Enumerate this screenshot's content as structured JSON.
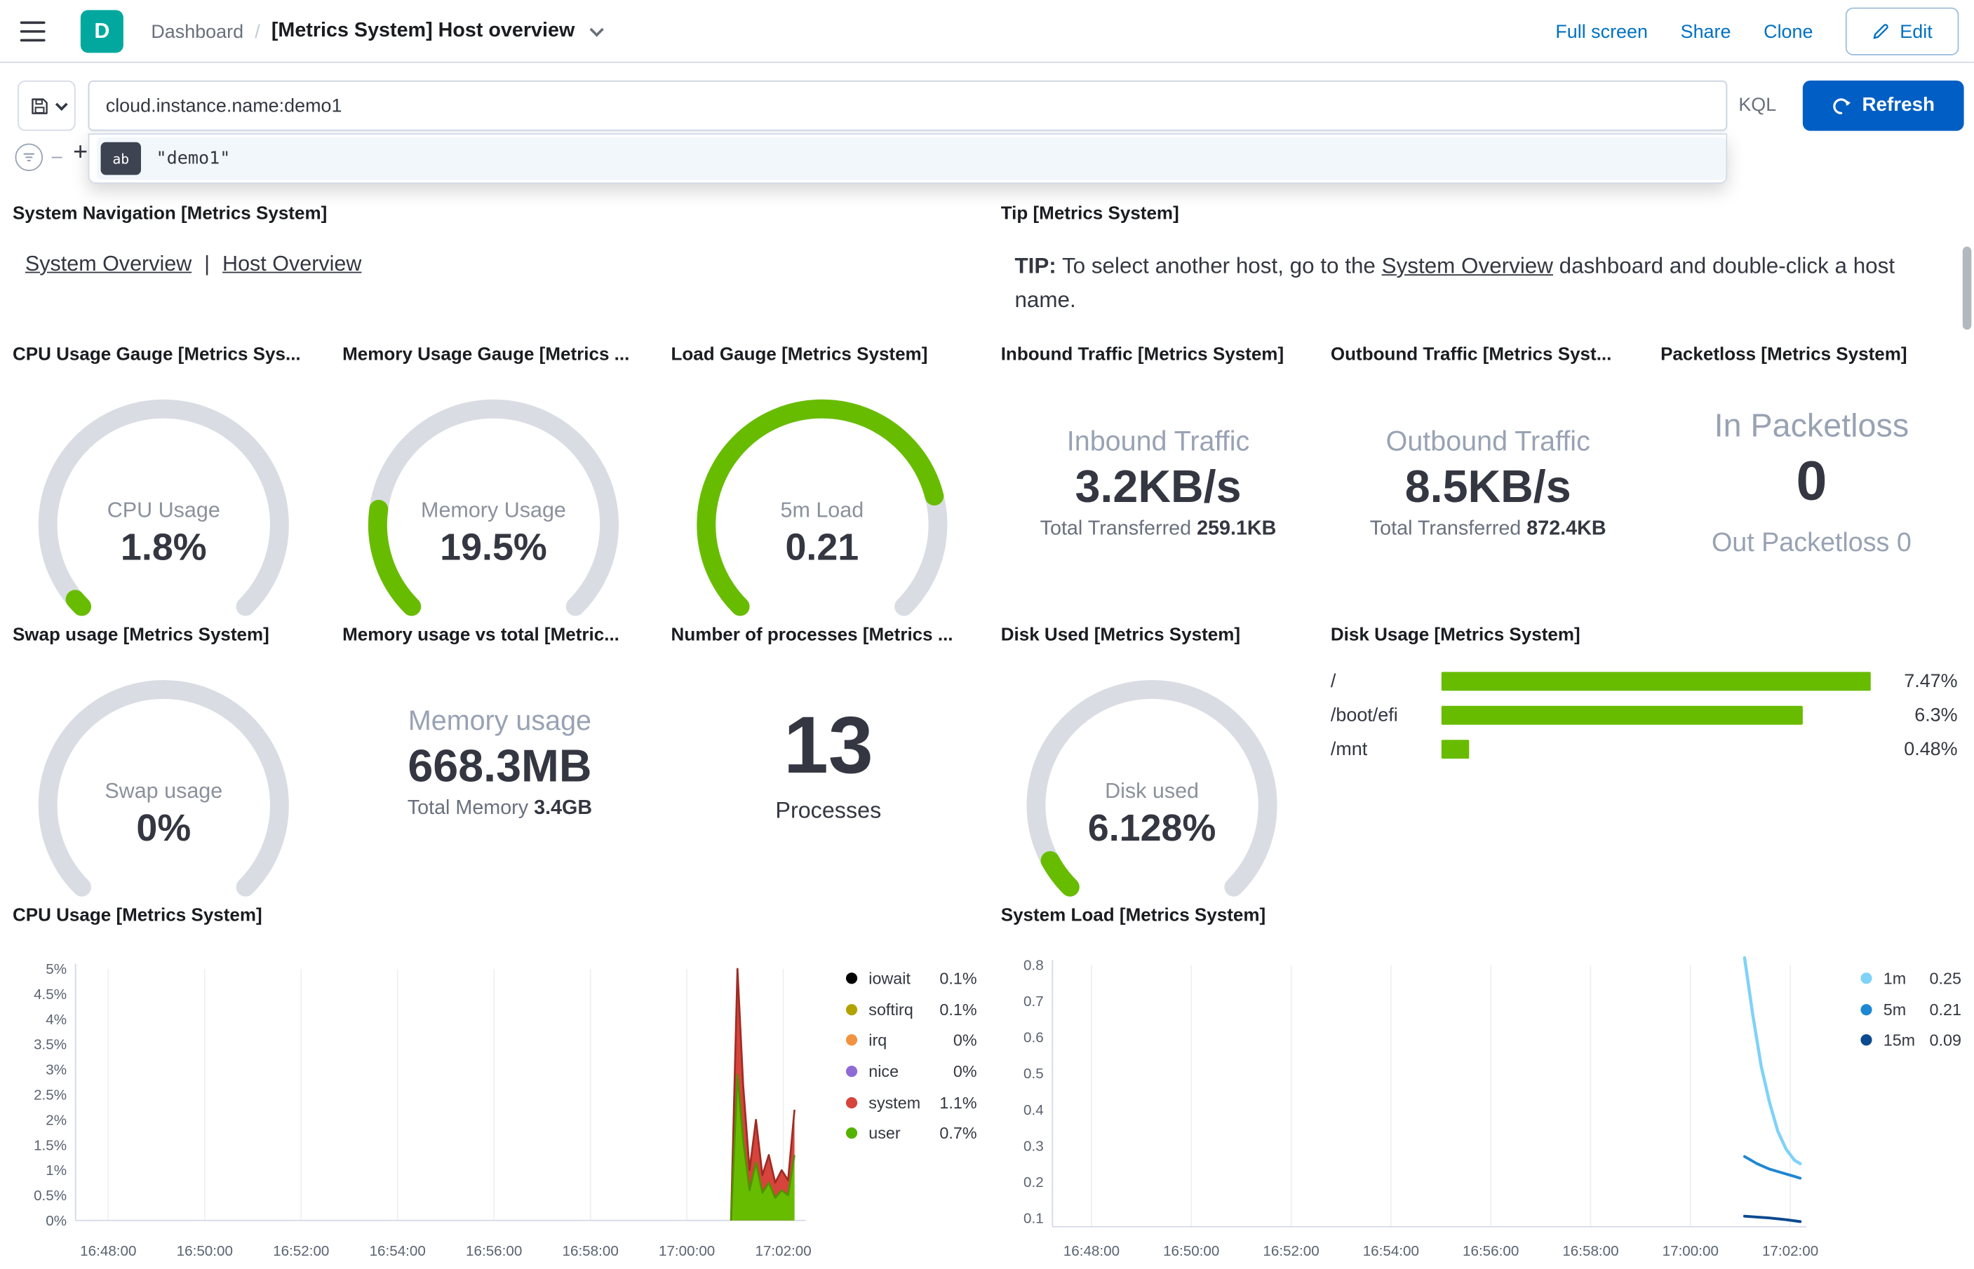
{
  "header": {
    "logo_letter": "D",
    "breadcrumb_root": "Dashboard",
    "breadcrumb_sep": "/",
    "title": "[Metrics System] Host overview",
    "full_screen": "Full screen",
    "share": "Share",
    "clone": "Clone",
    "edit": "Edit"
  },
  "query_bar": {
    "query": "cloud.instance.name:demo1",
    "language": "KQL",
    "refresh": "Refresh",
    "suggestion_value": "\"demo1\"",
    "suggestion_icon_glyph": "ab",
    "add_filter_plus": "+",
    "filter_dash": "–"
  },
  "panels": {
    "system_navigation": {
      "title": "System Navigation [Metrics System]",
      "link1": "System Overview",
      "separator": "|",
      "link2": "Host Overview"
    },
    "tip": {
      "title": "Tip [Metrics System]",
      "bold": "TIP:",
      "pre": " To select another host, go to the ",
      "link": "System Overview",
      "post": " dashboard and double-click a host name."
    },
    "cpu_gauge": {
      "title": "CPU Usage Gauge [Metrics Sys...",
      "label": "CPU Usage",
      "value": "1.8%",
      "fraction": 0.018
    },
    "memory_gauge": {
      "title": "Memory Usage Gauge [Metrics ...",
      "label": "Memory Usage",
      "value": "19.5%",
      "fraction": 0.195
    },
    "load_gauge": {
      "title": "Load Gauge [Metrics System]",
      "label": "5m Load",
      "value": "0.21",
      "fraction": 0.78
    },
    "inbound": {
      "title": "Inbound Traffic [Metrics System]",
      "label": "Inbound Traffic",
      "value": "3.2KB/s",
      "sub_label": "Total Transferred",
      "sub_value": "259.1KB"
    },
    "outbound": {
      "title": "Outbound Traffic [Metrics Syst...",
      "label": "Outbound Traffic",
      "value": "8.5KB/s",
      "sub_label": "Total Transferred",
      "sub_value": "872.4KB"
    },
    "packetloss": {
      "title": "Packetloss [Metrics System]",
      "in_label": "In Packetloss",
      "in_value": "0",
      "out_label": "Out Packetloss",
      "out_value": "0"
    },
    "swap_gauge": {
      "title": "Swap usage [Metrics System]",
      "label": "Swap usage",
      "value": "0%",
      "fraction": 0
    },
    "memory_total": {
      "title": "Memory usage vs total [Metric...",
      "label": "Memory usage",
      "value": "668.3MB",
      "sub_label": "Total Memory",
      "sub_value": "3.4GB"
    },
    "processes": {
      "title": "Number of processes [Metrics ...",
      "value": "13",
      "label": "Processes"
    },
    "disk_used_gauge": {
      "title": "Disk Used [Metrics System]",
      "label": "Disk used",
      "value": "6.128%",
      "fraction": 0.061
    },
    "disk_usage": {
      "title": "Disk Usage [Metrics System]",
      "scale_max": 7.5,
      "rows": [
        {
          "label": "/",
          "value": 7.47,
          "display": "7.47%"
        },
        {
          "label": "/boot/efi",
          "value": 6.3,
          "display": "6.3%"
        },
        {
          "label": "/mnt",
          "value": 0.48,
          "display": "0.48%"
        }
      ]
    },
    "cpu_chart_title": "CPU Usage [Metrics System]",
    "load_chart_title": "System Load [Metrics System]"
  },
  "chart_data": [
    {
      "type": "area",
      "title": "CPU Usage [Metrics System]",
      "stacked": true,
      "x_ticks": [
        "16:48:00",
        "16:50:00",
        "16:52:00",
        "16:54:00",
        "16:56:00",
        "16:58:00",
        "17:00:00",
        "17:02:00"
      ],
      "y_ticks": [
        "5%",
        "4.5%",
        "4%",
        "3.5%",
        "3%",
        "2.5%",
        "2%",
        "1.5%",
        "1%",
        "0.5%",
        "0%"
      ],
      "ylim": [
        0,
        5
      ],
      "legend_position": "right",
      "grid": "vertical",
      "legend": [
        {
          "name": "iowait",
          "value": "0.1%",
          "color": "#000000"
        },
        {
          "name": "softirq",
          "value": "0.1%",
          "color": "#B2A200"
        },
        {
          "name": "irq",
          "value": "0%",
          "color": "#F19340"
        },
        {
          "name": "nice",
          "value": "0%",
          "color": "#8F6BD6"
        },
        {
          "name": "system",
          "value": "1.1%",
          "color": "#D6443C"
        },
        {
          "name": "user",
          "value": "0.7%",
          "color": "#54B300"
        }
      ],
      "series": [
        {
          "name": "user",
          "color": "#68BC00",
          "line": "#4F9302",
          "points": [
            [
              "17:00:55",
              0
            ],
            [
              "17:01:03",
              2.9
            ],
            [
              "17:01:10",
              1.6
            ],
            [
              "17:01:18",
              0.6
            ],
            [
              "17:01:26",
              1.15
            ],
            [
              "17:01:34",
              0.55
            ],
            [
              "17:01:42",
              0.75
            ],
            [
              "17:01:50",
              0.45
            ],
            [
              "17:01:58",
              0.6
            ],
            [
              "17:02:06",
              0.5
            ],
            [
              "17:02:14",
              1.3
            ]
          ]
        },
        {
          "name": "system",
          "color": "#D6443C",
          "line": "#9E2C24",
          "points": [
            [
              "17:00:55",
              0
            ],
            [
              "17:01:03",
              2.1
            ],
            [
              "17:01:10",
              1.1
            ],
            [
              "17:01:18",
              0.4
            ],
            [
              "17:01:26",
              0.85
            ],
            [
              "17:01:34",
              0.35
            ],
            [
              "17:01:42",
              0.55
            ],
            [
              "17:01:50",
              0.3
            ],
            [
              "17:01:58",
              0.4
            ],
            [
              "17:02:06",
              0.3
            ],
            [
              "17:02:14",
              0.9
            ]
          ]
        }
      ]
    },
    {
      "type": "line",
      "title": "System Load [Metrics System]",
      "x_ticks": [
        "16:48:00",
        "16:50:00",
        "16:52:00",
        "16:54:00",
        "16:56:00",
        "16:58:00",
        "17:00:00",
        "17:02:00"
      ],
      "y_ticks": [
        "0.8",
        "0.7",
        "0.6",
        "0.5",
        "0.4",
        "0.3",
        "0.2",
        "0.1"
      ],
      "ylim": [
        0.1,
        0.8
      ],
      "legend_position": "right",
      "grid": "vertical",
      "legend": [
        {
          "name": "1m",
          "value": "0.25",
          "color": "#7FD2F8"
        },
        {
          "name": "5m",
          "value": "0.21",
          "color": "#1E87D3"
        },
        {
          "name": "15m",
          "value": "0.09",
          "color": "#0B4A8F"
        }
      ],
      "series": [
        {
          "name": "1m",
          "color": "#7FD2F8",
          "width": 2.5,
          "points": [
            [
              "17:01:05",
              0.82
            ],
            [
              "17:01:15",
              0.66
            ],
            [
              "17:01:25",
              0.52
            ],
            [
              "17:01:35",
              0.42
            ],
            [
              "17:01:45",
              0.34
            ],
            [
              "17:01:55",
              0.29
            ],
            [
              "17:02:05",
              0.26
            ],
            [
              "17:02:12",
              0.25
            ]
          ]
        },
        {
          "name": "5m",
          "color": "#1E87D3",
          "width": 2.2,
          "points": [
            [
              "17:01:05",
              0.27
            ],
            [
              "17:01:20",
              0.25
            ],
            [
              "17:01:35",
              0.235
            ],
            [
              "17:01:50",
              0.225
            ],
            [
              "17:02:05",
              0.215
            ],
            [
              "17:02:12",
              0.21
            ]
          ]
        },
        {
          "name": "15m",
          "color": "#0B4A8F",
          "width": 2.2,
          "points": [
            [
              "17:01:05",
              0.105
            ],
            [
              "17:01:35",
              0.1
            ],
            [
              "17:01:55",
              0.095
            ],
            [
              "17:02:12",
              0.09
            ]
          ]
        }
      ]
    }
  ],
  "colors": {
    "accent_link": "#0071C2",
    "button_blue": "#005EC4",
    "gauge_green": "#68BC00",
    "gauge_track": "#D9DDE3",
    "logo_teal": "#02A89E"
  }
}
